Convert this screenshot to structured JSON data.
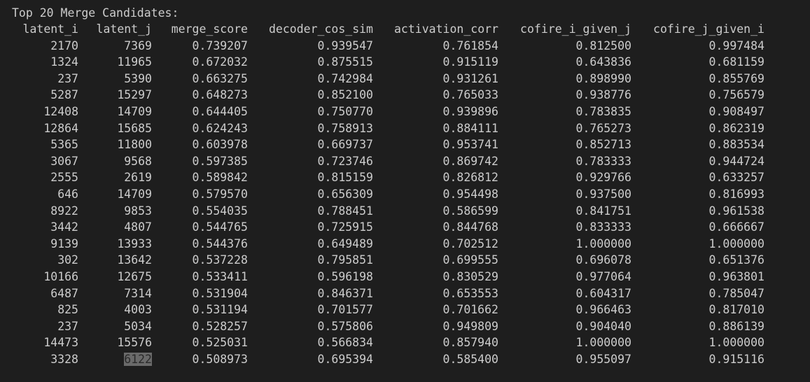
{
  "terminal": {
    "title": "Top 20 Merge Candidates:",
    "headers": [
      "latent_i",
      "latent_j",
      "merge_score",
      "decoder_cos_sim",
      "activation_corr",
      "cofire_i_given_j",
      "cofire_j_given_i"
    ],
    "rows": [
      [
        "2170",
        "7369",
        "0.739207",
        "0.939547",
        "0.761854",
        "0.812500",
        "0.997484"
      ],
      [
        "1324",
        "11965",
        "0.672032",
        "0.875515",
        "0.915119",
        "0.643836",
        "0.681159"
      ],
      [
        "237",
        "5390",
        "0.663275",
        "0.742984",
        "0.931261",
        "0.898990",
        "0.855769"
      ],
      [
        "5287",
        "15297",
        "0.648273",
        "0.852100",
        "0.765033",
        "0.938776",
        "0.756579"
      ],
      [
        "12408",
        "14709",
        "0.644405",
        "0.750770",
        "0.939896",
        "0.783835",
        "0.908497"
      ],
      [
        "12864",
        "15685",
        "0.624243",
        "0.758913",
        "0.884111",
        "0.765273",
        "0.862319"
      ],
      [
        "5365",
        "11800",
        "0.603978",
        "0.669737",
        "0.953741",
        "0.852713",
        "0.883534"
      ],
      [
        "3067",
        "9568",
        "0.597385",
        "0.723746",
        "0.869742",
        "0.783333",
        "0.944724"
      ],
      [
        "2555",
        "2619",
        "0.589842",
        "0.815159",
        "0.826812",
        "0.929766",
        "0.633257"
      ],
      [
        "646",
        "14709",
        "0.579570",
        "0.656309",
        "0.954498",
        "0.937500",
        "0.816993"
      ],
      [
        "8922",
        "9853",
        "0.554035",
        "0.788451",
        "0.586599",
        "0.841751",
        "0.961538"
      ],
      [
        "3442",
        "4807",
        "0.544765",
        "0.725915",
        "0.844768",
        "0.833333",
        "0.666667"
      ],
      [
        "9139",
        "13933",
        "0.544376",
        "0.649489",
        "0.702512",
        "1.000000",
        "1.000000"
      ],
      [
        "302",
        "13642",
        "0.537228",
        "0.795851",
        "0.699555",
        "0.696078",
        "0.651376"
      ],
      [
        "10166",
        "12675",
        "0.533411",
        "0.596198",
        "0.830529",
        "0.977064",
        "0.963801"
      ],
      [
        "6487",
        "7314",
        "0.531904",
        "0.846371",
        "0.653553",
        "0.604317",
        "0.785047"
      ],
      [
        "825",
        "4003",
        "0.531194",
        "0.701577",
        "0.701662",
        "0.966463",
        "0.817010"
      ],
      [
        "237",
        "5034",
        "0.528257",
        "0.575806",
        "0.949809",
        "0.904040",
        "0.886139"
      ],
      [
        "14473",
        "15576",
        "0.525031",
        "0.566834",
        "0.857940",
        "1.000000",
        "1.000000"
      ],
      [
        "3328",
        "6122",
        "0.508973",
        "0.695394",
        "0.585400",
        "0.955097",
        "0.915116"
      ]
    ],
    "selected_row": 19,
    "selected_col": 1
  },
  "colors": {
    "background": "#1e1e1e",
    "text": "#cccccc",
    "selection_background": "#6a6a6a",
    "selection_text": "#2a2a2a"
  }
}
